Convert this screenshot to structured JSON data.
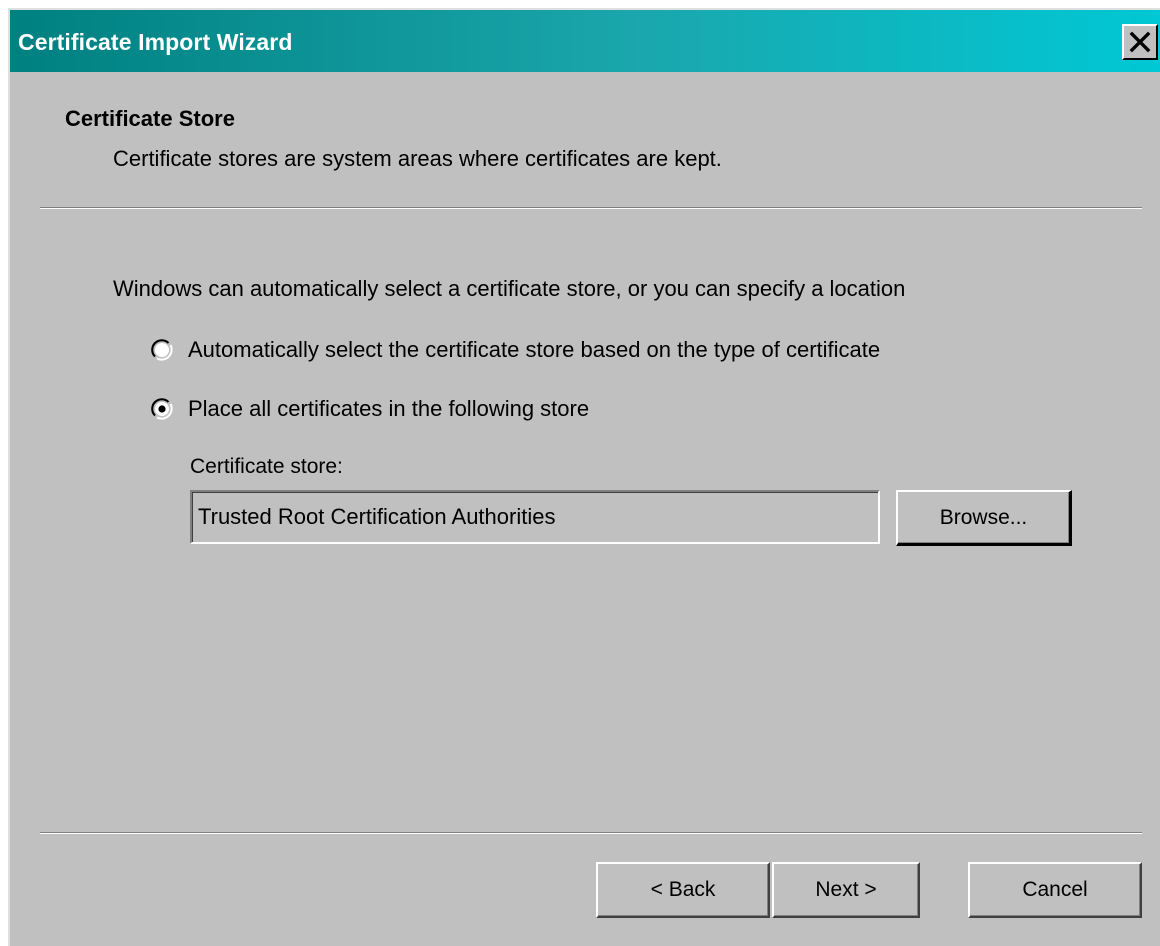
{
  "window": {
    "title": "Certificate Import Wizard",
    "close_icon": "close-icon",
    "colors": {
      "title_gradient_start": "#008080",
      "title_gradient_end": "#00c8d4",
      "face": "#c0c0c0"
    }
  },
  "header": {
    "title": "Certificate Store",
    "subtitle": "Certificate stores are system areas where certificates are kept."
  },
  "body": {
    "intro": "Windows can automatically select a certificate store, or you can specify a location",
    "options": [
      {
        "label": "Automatically select the certificate store based on the type of certificate",
        "selected": false
      },
      {
        "label": "Place all certificates in the following store",
        "selected": true
      }
    ],
    "store": {
      "label": "Certificate store:",
      "value": "Trusted Root Certification Authorities",
      "browse_label": "Browse..."
    }
  },
  "footer": {
    "back_label": "< Back",
    "next_label": "Next >",
    "cancel_label": "Cancel"
  }
}
